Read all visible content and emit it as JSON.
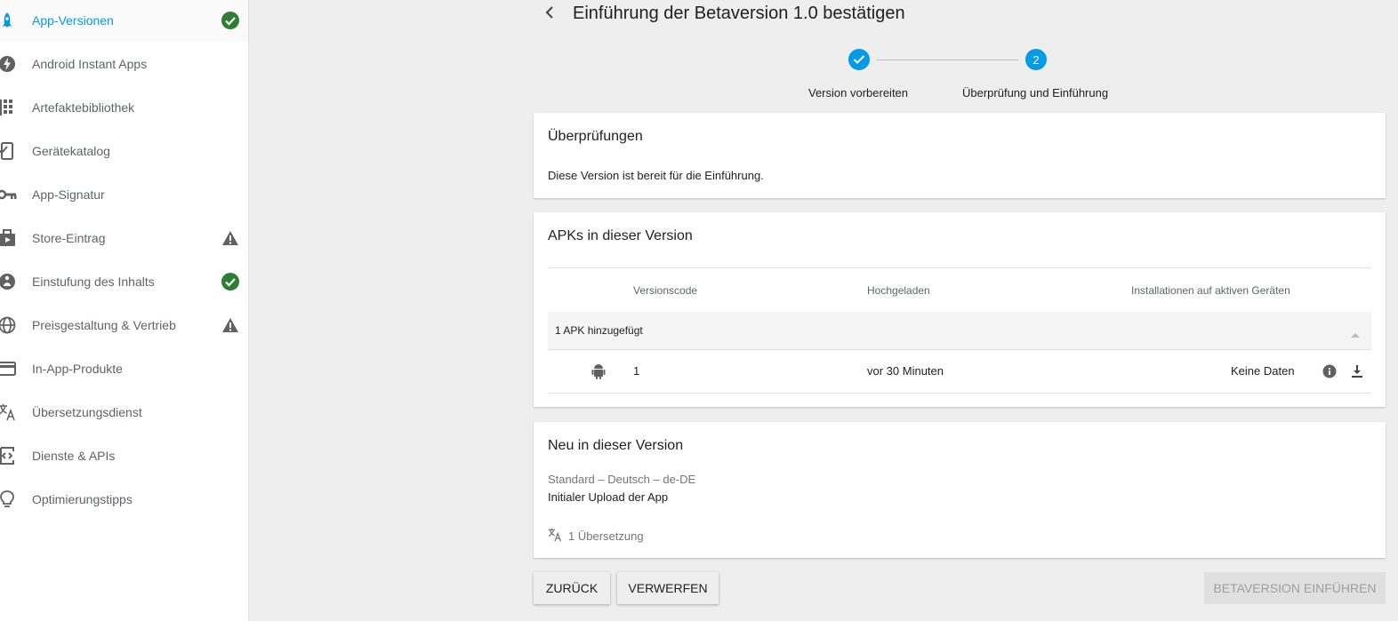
{
  "sidebar": {
    "items": [
      {
        "label": "App-Versionen",
        "icon": "rocket-icon",
        "status": "check",
        "active": true
      },
      {
        "label": "Android Instant Apps",
        "icon": "lightning-icon",
        "status": ""
      },
      {
        "label": "Artefaktebibliothek",
        "icon": "grid-icon",
        "status": ""
      },
      {
        "label": "Gerätekatalog",
        "icon": "device-check-icon",
        "status": ""
      },
      {
        "label": "App-Signatur",
        "icon": "key-icon",
        "status": ""
      },
      {
        "label": "Store-Eintrag",
        "icon": "store-icon",
        "status": "warning"
      },
      {
        "label": "Einstufung des Inhalts",
        "icon": "rating-icon",
        "status": "check"
      },
      {
        "label": "Preisgestaltung & Vertrieb",
        "icon": "globe-icon",
        "status": "warning"
      },
      {
        "label": "In-App-Produkte",
        "icon": "card-icon",
        "status": ""
      },
      {
        "label": "Übersetzungsdienst",
        "icon": "translate-icon",
        "status": ""
      },
      {
        "label": "Dienste & APIs",
        "icon": "api-icon",
        "status": ""
      },
      {
        "label": "Optimierungstipps",
        "icon": "lightbulb-icon",
        "status": ""
      }
    ]
  },
  "header": {
    "title": "Einführung der Betaversion 1.0 bestätigen"
  },
  "stepper": {
    "steps": [
      {
        "label": "Version vorbereiten",
        "state": "done"
      },
      {
        "label": "Überprüfung und Einführung",
        "number": "2",
        "state": "active"
      }
    ]
  },
  "review_card": {
    "title": "Überprüfungen",
    "message": "Diese Version ist bereit für die Einführung."
  },
  "apk_card": {
    "title": "APKs in dieser Version",
    "columns": {
      "version_code": "Versionscode",
      "uploaded": "Hochgeladen",
      "installs": "Installationen auf aktiven Geräten"
    },
    "group_label": "1 APK hinzugefügt",
    "rows": [
      {
        "version_code": "1",
        "uploaded": "vor 30 Minuten",
        "installs": "Keine Daten"
      }
    ]
  },
  "release_notes_card": {
    "title": "Neu in dieser Version",
    "language": "Standard – Deutsch – de-DE",
    "note": "Initialer Upload der App",
    "translations": "1 Übersetzung"
  },
  "footer": {
    "back_label": "ZURÜCK",
    "discard_label": "VERWERFEN",
    "rollout_label": "BETAVERSION EINFÜHREN"
  },
  "colors": {
    "accent": "#039be5",
    "success": "#2e7d32",
    "warning": "#616161"
  }
}
